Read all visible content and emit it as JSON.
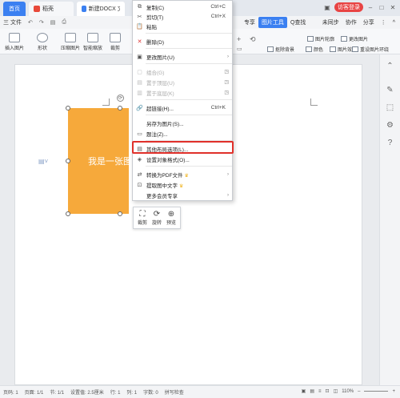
{
  "titlebar": {
    "tabs": [
      {
        "label": "首页"
      },
      {
        "label": "稻壳"
      },
      {
        "label": "新建DOCX 文档.d"
      }
    ],
    "login_label": "访客登录"
  },
  "menubar": {
    "file_label": "三 文件",
    "start_label": "开始",
    "insert_label": "插入",
    "special_label": "专享",
    "picture_tools_label": "图片工具",
    "search_label": "Q查找",
    "sync_label": "未同步",
    "collab_label": "协作",
    "share_label": "分享"
  },
  "ribbon": {
    "buttons": [
      "插入图片",
      "形状",
      "压缩图片",
      "智能缩放",
      "裁剪"
    ],
    "right_buttons": [
      "图片轮廓",
      "更改图片",
      "抠除背景",
      "颜色",
      "图片效果",
      "重设图片",
      "环绕"
    ]
  },
  "document": {
    "image_text": "我是一张图"
  },
  "image_toolbar": {
    "buttons": [
      {
        "label": "裁剪",
        "icon": "crop-icon"
      },
      {
        "label": "旋转",
        "icon": "rotate-icon"
      },
      {
        "label": "预览",
        "icon": "zoom-icon"
      }
    ]
  },
  "context_menu": {
    "items": [
      {
        "label": "复制(C)",
        "shortcut": "Ctrl+C",
        "icon": "copy-icon"
      },
      {
        "label": "剪切(T)",
        "shortcut": "Ctrl+X",
        "icon": "cut-icon"
      },
      {
        "label": "粘贴",
        "icon": "paste-icon"
      },
      {
        "label": "删除(D)",
        "icon": "delete-icon"
      },
      {
        "label": "更改图片(U)",
        "icon": "change-picture-icon"
      },
      {
        "label": "组合(G)",
        "icon": "group-icon"
      },
      {
        "label": "置于顶层(U)",
        "icon": "bring-to-front-icon"
      },
      {
        "label": "置于底层(K)",
        "icon": "send-to-back-icon"
      },
      {
        "label": "超链接(H)...",
        "shortcut": "Ctrl+K",
        "icon": "hyperlink-icon"
      },
      {
        "label": "另存为图片(S)..."
      },
      {
        "label": "题注(Z)...",
        "icon": "caption-icon"
      },
      {
        "label": "其他布局选项(L)...",
        "icon": "layout-options-icon"
      },
      {
        "label": "设置对象格式(O)...",
        "icon": "format-object-icon"
      },
      {
        "label": "转换为PDF文件",
        "icon": "pdf-icon"
      },
      {
        "label": "提取图中文字",
        "icon": "extract-text-icon"
      },
      {
        "label": "更多会员专享"
      }
    ]
  },
  "statusbar": {
    "page": "页码: 1",
    "pages": "页面: 1/1",
    "section": "节: 1/1",
    "position": "设置值: 2.5厘米",
    "line": "行: 1",
    "column": "列: 1",
    "words": "字数: 0",
    "spellcheck": "拼写检查",
    "zoom": "110%"
  },
  "colors": {
    "accent": "#3b80f1",
    "image_fill": "#f6a93b",
    "highlight": "#e0302a"
  }
}
